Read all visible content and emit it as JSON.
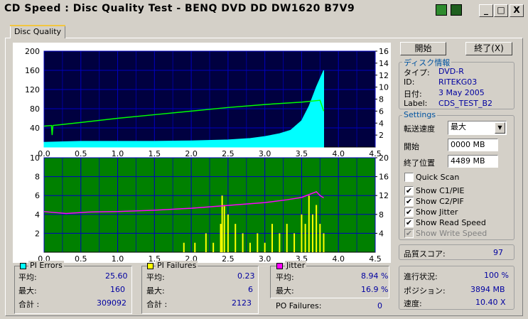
{
  "window": {
    "title": "CD Speed : Disc Quality Test - BENQ     DVD DD DW1620     B7V9",
    "buttons": {
      "minimize": "_",
      "maximize": "□",
      "close": "X"
    }
  },
  "tab": {
    "label": "Disc Quality"
  },
  "controls": {
    "start_label": "開始",
    "stop_label": "終了(X)"
  },
  "disc_info": {
    "legend": "ディスク情報",
    "rows": [
      {
        "label": "タイプ:",
        "value": "DVD-R"
      },
      {
        "label": "ID:",
        "value": "RITEKG03"
      },
      {
        "label": "日付:",
        "value": "3 May 2005"
      },
      {
        "label": "Label:",
        "value": "CDS_TEST_B2"
      }
    ]
  },
  "settings": {
    "legend": "Settings",
    "speed_label": "転送速度",
    "speed_value": "最大",
    "start_label": "開始",
    "start_value": "0000 MB",
    "end_label": "終了位置",
    "end_value": "4489 MB",
    "checkboxes": [
      {
        "label": "Quick Scan",
        "checked": false,
        "disabled": false
      },
      {
        "label": "Show C1/PIE",
        "checked": true,
        "disabled": false
      },
      {
        "label": "Show C2/PIF",
        "checked": true,
        "disabled": false
      },
      {
        "label": "Show Jitter",
        "checked": true,
        "disabled": false
      },
      {
        "label": "Show Read Speed",
        "checked": true,
        "disabled": false
      },
      {
        "label": "Show Write Speed",
        "checked": true,
        "disabled": true
      }
    ]
  },
  "quality": {
    "label": "品質スコア:",
    "value": "97"
  },
  "progress": {
    "rows": [
      {
        "label": "進行状況:",
        "value": "100 %"
      },
      {
        "label": "ポジション:",
        "value": "3894 MB"
      },
      {
        "label": "速度:",
        "value": "10.40 X"
      }
    ]
  },
  "pi_errors": {
    "legend": "PI Errors",
    "color": "#00ffff",
    "rows": [
      {
        "label": "平均:",
        "value": "25.60"
      },
      {
        "label": "最大:",
        "value": "160"
      },
      {
        "label": "合計 :",
        "value": "309092"
      }
    ]
  },
  "pi_failures": {
    "legend": "PI Failures",
    "color": "#ffff00",
    "rows": [
      {
        "label": "平均:",
        "value": "0.23"
      },
      {
        "label": "最大:",
        "value": "6"
      },
      {
        "label": "合計 :",
        "value": "2123"
      }
    ]
  },
  "jitter": {
    "legend": "Jitter",
    "color": "#ff00ff",
    "rows": [
      {
        "label": "平均:",
        "value": "8.94 %"
      },
      {
        "label": "最大:",
        "value": "16.9 %"
      }
    ]
  },
  "po_failures": {
    "label": "PO Failures:",
    "value": "0"
  },
  "chart_data": [
    {
      "type": "area",
      "name": "top-chart",
      "xlim": [
        0,
        4.5
      ],
      "ylim": [
        0,
        200
      ],
      "y2lim": [
        0,
        16
      ],
      "x_ticks": [
        "0.0",
        "0.5",
        "1.0",
        "1.5",
        "2.0",
        "2.5",
        "3.0",
        "3.5",
        "4.0",
        "4.5"
      ],
      "y_ticks": [
        "40",
        "80",
        "120",
        "160",
        "200"
      ],
      "y2_ticks": [
        "2",
        "4",
        "6",
        "8",
        "10",
        "12",
        "14",
        "16"
      ],
      "background": "#000040",
      "grid_color": "#0000c0",
      "series": [
        {
          "name": "PI Errors",
          "color": "#00ffff",
          "x": [
            0,
            0.5,
            1.0,
            1.5,
            2.0,
            2.5,
            2.8,
            3.0,
            3.2,
            3.35,
            3.5,
            3.6,
            3.7,
            3.8
          ],
          "y": [
            10,
            12,
            12,
            12,
            13,
            15,
            18,
            22,
            28,
            35,
            55,
            85,
            125,
            160
          ]
        },
        {
          "name": "Read Speed",
          "color": "#00ff00",
          "x": [
            0,
            0.1,
            0.11,
            0.12,
            0.5,
            1.0,
            1.5,
            2.0,
            2.5,
            3.0,
            3.5,
            3.75,
            3.8
          ],
          "y": [
            3.5,
            3.6,
            2.0,
            3.6,
            4.1,
            4.8,
            5.4,
            6.0,
            6.6,
            7.1,
            7.5,
            7.8,
            6.0
          ]
        }
      ]
    },
    {
      "type": "area",
      "name": "bottom-chart",
      "xlim": [
        0,
        4.5
      ],
      "ylim": [
        0,
        10
      ],
      "y2lim": [
        0,
        20
      ],
      "x_ticks": [
        "0.0",
        "0.5",
        "1.0",
        "1.5",
        "2.0",
        "2.5",
        "3.0",
        "3.5",
        "4.0",
        "4.5"
      ],
      "y_ticks": [
        "2",
        "4",
        "6",
        "8",
        "10"
      ],
      "y2_ticks": [
        "4",
        "8",
        "12",
        "16",
        "20"
      ],
      "background": "#008000",
      "grid_color": "#0000c0",
      "series": [
        {
          "name": "PI Failures",
          "color": "#ffff00",
          "x": [
            1.9,
            2.05,
            2.2,
            2.3,
            2.4,
            2.42,
            2.45,
            2.5,
            2.6,
            2.7,
            2.8,
            2.9,
            3.0,
            3.1,
            3.2,
            3.3,
            3.4,
            3.5,
            3.55,
            3.6,
            3.65,
            3.7,
            3.75,
            3.8
          ],
          "y": [
            1,
            1,
            2,
            1,
            3,
            6,
            5,
            4,
            3,
            2,
            1,
            2,
            1,
            3,
            2,
            3,
            2,
            4,
            3,
            6,
            4,
            5,
            3,
            2
          ]
        },
        {
          "name": "Jitter",
          "color": "#ff00ff",
          "x": [
            0,
            0.3,
            0.6,
            1.0,
            1.5,
            2.0,
            2.5,
            3.0,
            3.3,
            3.5,
            3.6,
            3.7,
            3.75,
            3.8
          ],
          "y": [
            8.6,
            8.2,
            8.5,
            8.6,
            8.9,
            9.3,
            9.9,
            10.5,
            11.1,
            11.6,
            12.2,
            12.8,
            12.0,
            11.5
          ]
        }
      ]
    }
  ]
}
